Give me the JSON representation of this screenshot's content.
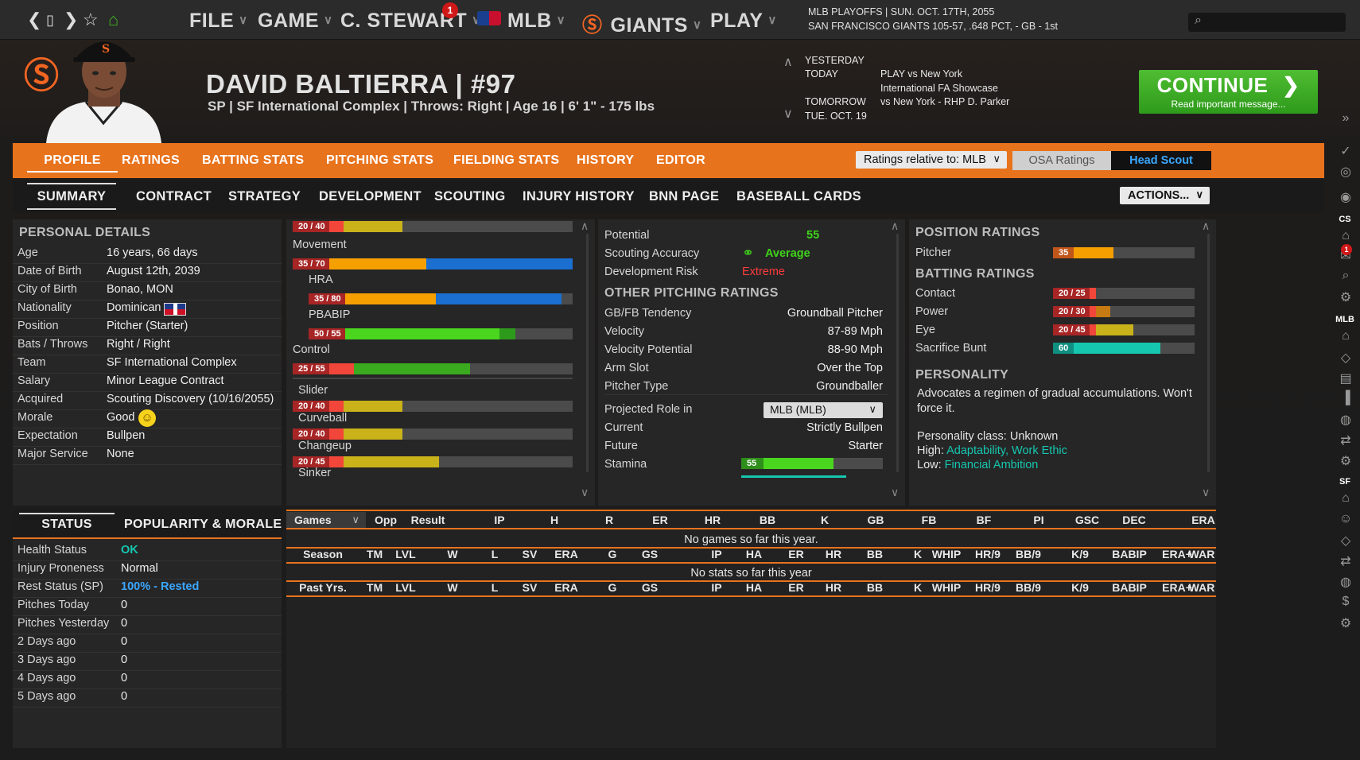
{
  "topbar": {
    "menus": [
      "FILE",
      "GAME",
      "C. STEWART",
      "MLB",
      "GIANTS",
      "PLAY"
    ],
    "notif_count": "1",
    "status_line1": "MLB PLAYOFFS  |  SUN. OCT. 17TH, 2055",
    "status_line2": "SAN FRANCISCO GIANTS   105-57, .648 PCT, - GB - 1st",
    "search_placeholder": ""
  },
  "player": {
    "name": "DAVID BALTIERRA  |  #97",
    "subtitle": "SP | SF International Complex  |  Throws: Right  |  Age 16  |  6' 1\" - 175 lbs"
  },
  "schedule": {
    "yesterday": "YESTERDAY",
    "today": "TODAY",
    "tomorrow": "TOMORROW",
    "tue": "TUE. OCT. 19",
    "today_evt1": "PLAY vs New York",
    "today_evt2": "International FA Showcase",
    "tomorrow_evt": "vs New York - RHP D. Parker"
  },
  "continue_button": {
    "label": "CONTINUE",
    "sub": "Read important message..."
  },
  "tabs_main": [
    "PROFILE",
    "RATINGS",
    "BATTING STATS",
    "PITCHING STATS",
    "FIELDING STATS",
    "HISTORY",
    "EDITOR"
  ],
  "ratings_relative": "Ratings relative to: MLB",
  "osa_ratings": "OSA Ratings",
  "head_scout": "Head Scout",
  "tabs_sub": [
    "SUMMARY",
    "CONTRACT",
    "STRATEGY",
    "DEVELOPMENT",
    "SCOUTING",
    "INJURY HISTORY",
    "BNN PAGE",
    "BASEBALL CARDS"
  ],
  "actions": "ACTIONS...",
  "personal": {
    "title": "PERSONAL DETAILS",
    "rows": [
      [
        "Age",
        "16 years, 66 days"
      ],
      [
        "Date of Birth",
        "August 12th, 2039"
      ],
      [
        "City of Birth",
        "Bonao, MON"
      ],
      [
        "Nationality",
        "Dominican"
      ],
      [
        "Position",
        "Pitcher (Starter)"
      ],
      [
        "Bats / Throws",
        "Right / Right"
      ],
      [
        "Team",
        "SF International Complex"
      ],
      [
        "Salary",
        "Minor League Contract"
      ],
      [
        "Acquired",
        "Scouting Discovery (10/16/2055)"
      ],
      [
        "Morale",
        "Good"
      ],
      [
        "Expectation",
        "Bullpen"
      ],
      [
        "Major Service",
        "None"
      ]
    ]
  },
  "status": {
    "tab1": "STATUS",
    "tab2": "POPULARITY & MORALE",
    "rows": [
      [
        "Health Status",
        "OK"
      ],
      [
        "Injury Proneness",
        "Normal"
      ],
      [
        "Rest Status (SP)",
        "100% - Rested"
      ],
      [
        "Pitches Today",
        "0"
      ],
      [
        "Pitches Yesterday",
        "0"
      ],
      [
        "2 Days ago",
        "0"
      ],
      [
        "3 Days ago",
        "0"
      ],
      [
        "4 Days ago",
        "0"
      ],
      [
        "5 Days ago",
        "0"
      ]
    ]
  },
  "pitch_ratings": {
    "top_label": "20 / 40",
    "movement": "Movement",
    "movement_val": "35 / 70",
    "hra": "HRA",
    "hra_val": "35 / 80",
    "pbabip": "PBABIP",
    "pbabip_val": "50 / 55",
    "control": "Control",
    "control_val": "25 / 55",
    "slider": "Slider",
    "slider_val": "20 / 40",
    "curveball": "Curveball",
    "curveball_val": "20 / 40",
    "changeup": "Changeup",
    "changeup_val": "20 / 45",
    "sinker": "Sinker"
  },
  "scouting": {
    "potential_lbl": "Potential",
    "potential": "55",
    "accuracy_lbl": "Scouting Accuracy",
    "accuracy": "Average",
    "risk_lbl": "Development Risk",
    "risk": "Extreme",
    "other_title": "OTHER PITCHING RATINGS",
    "rows": [
      [
        "GB/FB Tendency",
        "Groundball Pitcher"
      ],
      [
        "Velocity",
        "87-89 Mph"
      ],
      [
        "Velocity Potential",
        "88-90 Mph"
      ],
      [
        "Arm Slot",
        "Over the Top"
      ],
      [
        "Pitcher Type",
        "Groundballer"
      ]
    ],
    "role_lbl": "Projected Role in",
    "role_select": "MLB (MLB)",
    "current_lbl": "Current",
    "current": "Strictly Bullpen",
    "future_lbl": "Future",
    "future": "Starter",
    "stamina_lbl": "Stamina",
    "stamina": "55"
  },
  "position": {
    "title": "POSITION RATINGS",
    "pitcher_lbl": "Pitcher",
    "pitcher": "35",
    "batting_title": "BATTING RATINGS",
    "batting": [
      [
        "Contact",
        "20 / 25"
      ],
      [
        "Power",
        "20 / 30"
      ],
      [
        "Eye",
        "20 / 45"
      ],
      [
        "Sacrifice Bunt",
        "60"
      ]
    ],
    "personality_title": "PERSONALITY",
    "personality_text": "Advocates a regimen of gradual accumulations. Won't force it.",
    "class_line": "Personality class: Unknown",
    "high_lbl": "High:",
    "high": "Adaptability, Work Ethic",
    "low_lbl": "Low:",
    "low": "Financial Ambition"
  },
  "stats": {
    "games_select": "Games",
    "games_cols": [
      "Opp",
      "Result",
      "IP",
      "H",
      "R",
      "ER",
      "HR",
      "BB",
      "K",
      "GB",
      "FB",
      "BF",
      "PI",
      "GSC",
      "DEC",
      "ERA"
    ],
    "no_games": "No games so far this year.",
    "season_cols": [
      "Season",
      "TM",
      "LVL",
      "W",
      "L",
      "SV",
      "ERA",
      "G",
      "GS",
      "IP",
      "HA",
      "ER",
      "HR",
      "BB",
      "K",
      "WHIP",
      "HR/9",
      "BB/9",
      "K/9",
      "BABIP",
      "ERA+",
      "WAR"
    ],
    "no_stats": "No stats so far this year",
    "past_cols": [
      "Past Yrs.",
      "TM",
      "LVL",
      "W",
      "L",
      "SV",
      "ERA",
      "G",
      "GS",
      "IP",
      "HA",
      "ER",
      "HR",
      "BB",
      "K",
      "WHIP",
      "HR/9",
      "BB/9",
      "K/9",
      "BABIP",
      "ERA+",
      "WAR"
    ]
  },
  "sidebar": {
    "cs": "CS",
    "mlb": "MLB",
    "sf": "SF",
    "badge": "1"
  },
  "colors": {
    "accent": "#e8731d",
    "green": "#3aaa1f",
    "teal": "#16c7b0",
    "blue": "#1a6fd0"
  }
}
